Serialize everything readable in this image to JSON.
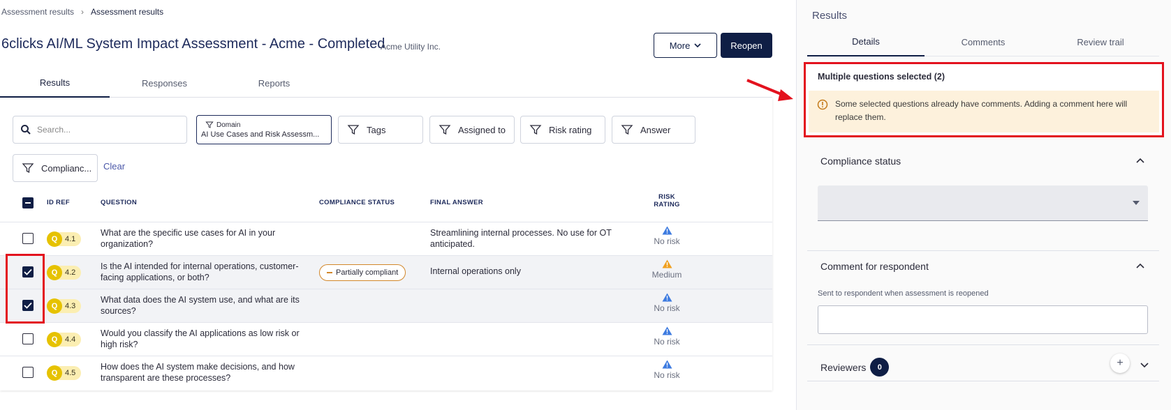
{
  "breadcrumb": {
    "items": [
      "Assessment results",
      "Assessment results"
    ]
  },
  "header": {
    "title": "6clicks AI/ML System Impact Assessment - Acme - Completed",
    "org": "Acme Utility Inc.",
    "more_label": "More",
    "reopen_label": "Reopen"
  },
  "tabs": [
    "Results",
    "Responses",
    "Reports"
  ],
  "filters": {
    "search_placeholder": "Search...",
    "domain_label": "Domain",
    "domain_value": "AI Use Cases and Risk Assessm...",
    "tags": "Tags",
    "assigned_to": "Assigned to",
    "risk_rating": "Risk rating",
    "answer": "Answer",
    "compliance": "Complianc...",
    "clear": "Clear"
  },
  "table": {
    "headers": {
      "id_ref": "ID REF",
      "question": "QUESTION",
      "compliance_status": "COMPLIANCE STATUS",
      "final_answer": "FINAL ANSWER",
      "risk_rating_1": "RISK",
      "risk_rating_2": "RATING"
    },
    "rows": [
      {
        "badge": "Q",
        "id": "4.1",
        "question": "What are the specific use cases for AI in your organization?",
        "compliance": "",
        "final_answer": "Streamlining internal processes. No use for OT anticipated.",
        "risk": "No risk",
        "selected": false
      },
      {
        "badge": "Q",
        "id": "4.2",
        "question": "Is the AI intended for internal operations, customer-facing applications, or both?",
        "compliance": "Partially compliant",
        "final_answer": "Internal operations only",
        "risk": "Medium",
        "selected": true
      },
      {
        "badge": "Q",
        "id": "4.3",
        "question": "What data does the AI system use, and what are its sources?",
        "compliance": "",
        "final_answer": "",
        "risk": "No risk",
        "selected": true
      },
      {
        "badge": "Q",
        "id": "4.4",
        "question": "Would you classify the AI applications as low risk or high risk?",
        "compliance": "",
        "final_answer": "",
        "risk": "No risk",
        "selected": false
      },
      {
        "badge": "Q",
        "id": "4.5",
        "question": "How does the AI system make decisions, and how transparent are these processes?",
        "compliance": "",
        "final_answer": "",
        "risk": "No risk",
        "selected": false
      }
    ]
  },
  "results_panel": {
    "title": "Results",
    "tabs": [
      "Details",
      "Comments",
      "Review trail"
    ],
    "selection_title": "Multiple questions selected (2)",
    "warning": "Some selected questions already have comments. Adding a comment here will replace them.",
    "compliance_status_label": "Compliance status",
    "comment_label": "Comment for respondent",
    "comment_hint": "Sent to respondent when assessment is reopened",
    "reviewers_label": "Reviewers",
    "reviewers_count": "0",
    "add_symbol": "+"
  },
  "colors": {
    "primary": "#0f1e45",
    "accent_red": "#e3121e",
    "warning_bg": "#fdf1dc",
    "badge_yellow": "#e6c200",
    "risk_blue": "#3d7be0",
    "risk_orange": "#f0a020"
  }
}
